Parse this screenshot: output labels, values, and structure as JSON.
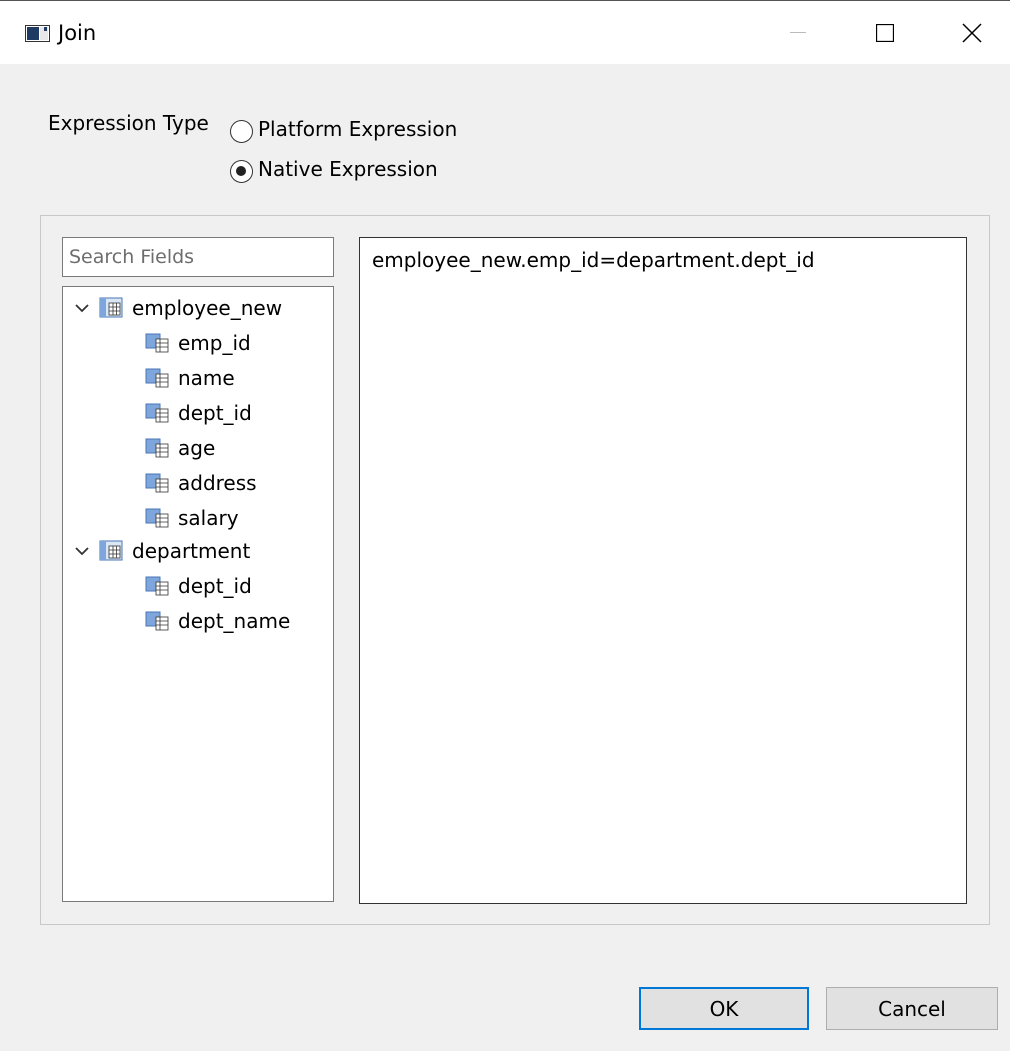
{
  "window": {
    "title": "Join"
  },
  "expression": {
    "label": "Expression Type",
    "options": [
      "Platform Expression",
      "Native Expression"
    ],
    "selected": "Native Expression"
  },
  "search": {
    "placeholder": "Search Fields"
  },
  "tree": [
    {
      "label": "employee_new",
      "icon": "table-icon",
      "expanded": true,
      "children": [
        "emp_id",
        "name",
        "dept_id",
        "age",
        "address",
        "salary"
      ]
    },
    {
      "label": "department",
      "icon": "table-icon",
      "expanded": true,
      "children": [
        "dept_id",
        "dept_name"
      ]
    }
  ],
  "editor": {
    "text": "employee_new.emp_id=department.dept_id"
  },
  "buttons": {
    "ok": "OK",
    "cancel": "Cancel"
  },
  "colors": {
    "accent": "#0078d7",
    "background": "#f0f0f0"
  }
}
